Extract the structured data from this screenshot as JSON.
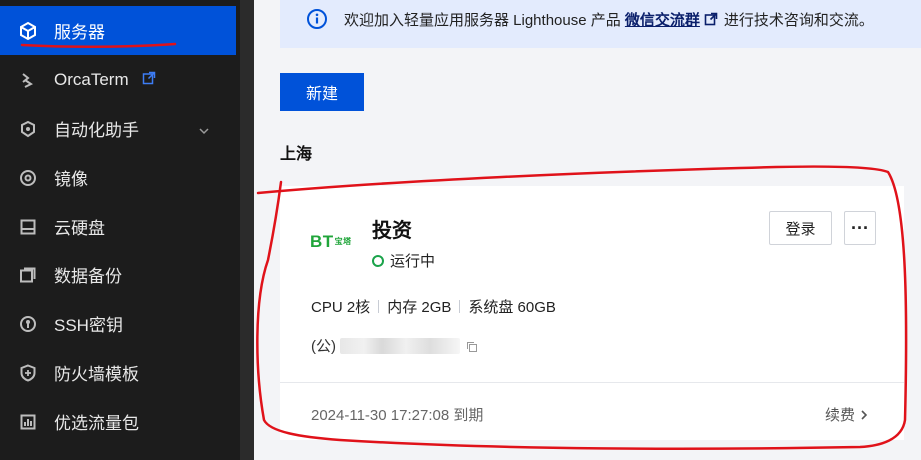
{
  "sidebar": {
    "items": [
      {
        "label": "服务器",
        "icon": "cube-icon",
        "active": true
      },
      {
        "label": "OrcaTerm",
        "icon": "orcaterm-icon",
        "external": true
      },
      {
        "label": "自动化助手",
        "icon": "automation-icon",
        "expandable": true
      },
      {
        "label": "镜像",
        "icon": "disc-icon"
      },
      {
        "label": "云硬盘",
        "icon": "disk-icon"
      },
      {
        "label": "数据备份",
        "icon": "backup-icon"
      },
      {
        "label": "SSH密钥",
        "icon": "key-icon"
      },
      {
        "label": "防火墙模板",
        "icon": "shield-icon"
      },
      {
        "label": "优选流量包",
        "icon": "traffic-icon"
      }
    ]
  },
  "notice": {
    "prefix": "欢迎加入轻量应用服务器 Lighthouse 产品",
    "link": "微信交流群",
    "suffix": "进行技术咨询和交流。"
  },
  "toolbar": {
    "new_label": "新建"
  },
  "region": {
    "title": "上海"
  },
  "instance": {
    "logo_text": "BT",
    "logo_small": "宝塔",
    "name": "投资",
    "status": "运行中",
    "login_label": "登录",
    "more_label": "···",
    "specs": [
      "CPU 2核",
      "内存 2GB",
      "系统盘 60GB"
    ],
    "ip_prefix": "(公)",
    "expire_text": "2024-11-30 17:27:08 到期",
    "renew_label": "续费"
  },
  "colors": {
    "accent": "#0052d9",
    "sidebar_bg": "#1c1c1c",
    "running": "#1aa34a",
    "annotation": "#e0121a"
  }
}
